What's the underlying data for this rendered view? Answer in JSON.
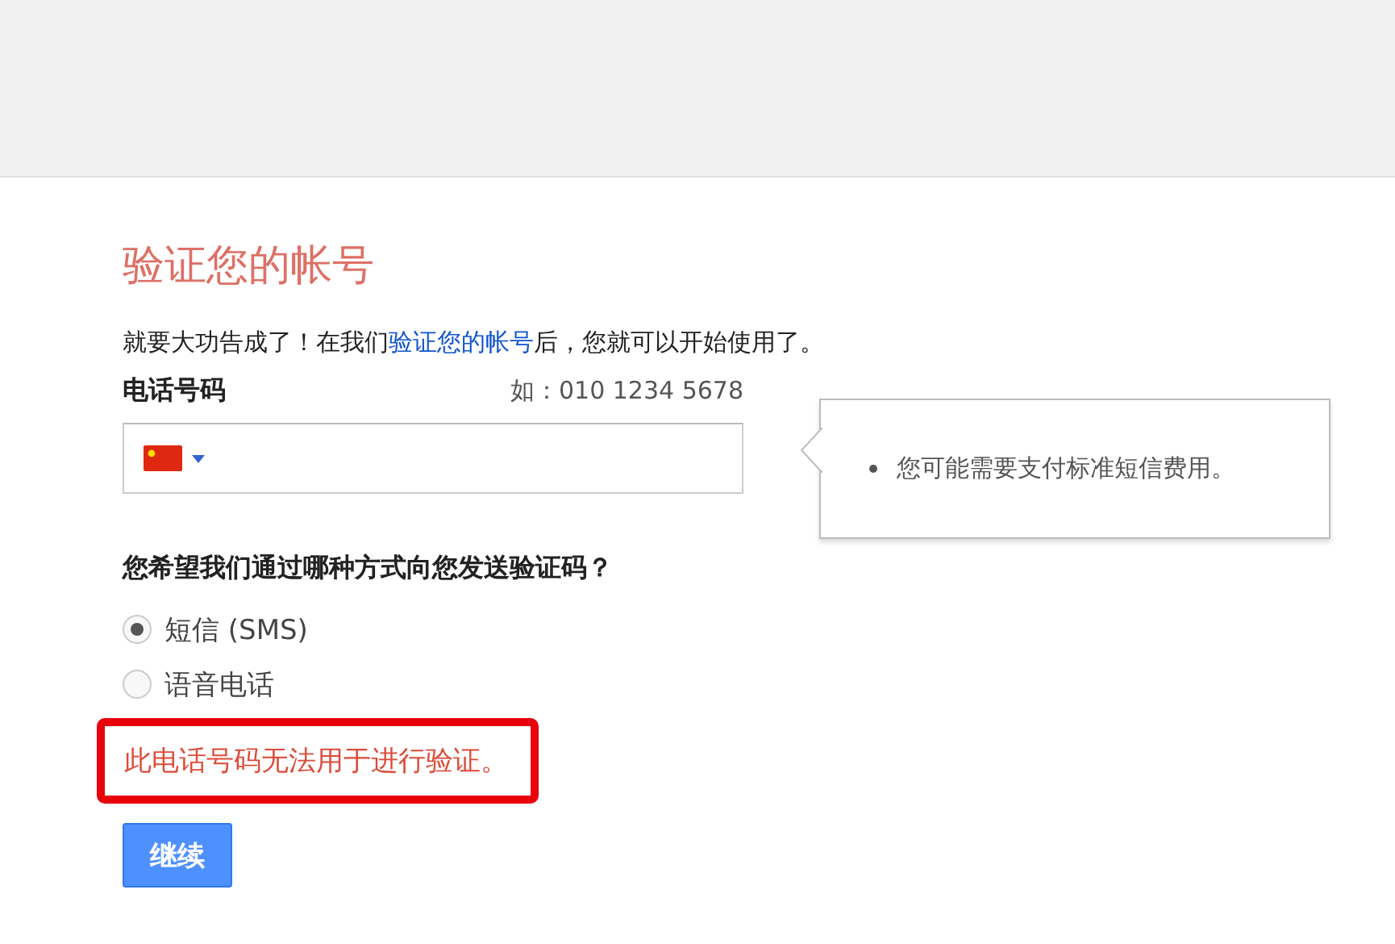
{
  "title": "验证您的帐号",
  "intro": {
    "before": "就要大功告成了！在我们",
    "link": "验证您的帐号",
    "after": "后，您就可以开始使用了。"
  },
  "phone": {
    "label": "电话号码",
    "hint": "如：010 1234 5678"
  },
  "tooltip": {
    "items": [
      "您可能需要支付标准短信费用。"
    ]
  },
  "method": {
    "question": "您希望我们通过哪种方式向您发送验证码？",
    "options": [
      {
        "label": "短信 (SMS)",
        "selected": true
      },
      {
        "label": "语音电话",
        "selected": false
      }
    ]
  },
  "error": {
    "text": "此电话号码无法用于进行验证。",
    "highlighted": true
  },
  "buttons": [
    {
      "label": "继续",
      "kind": "primary"
    }
  ]
}
